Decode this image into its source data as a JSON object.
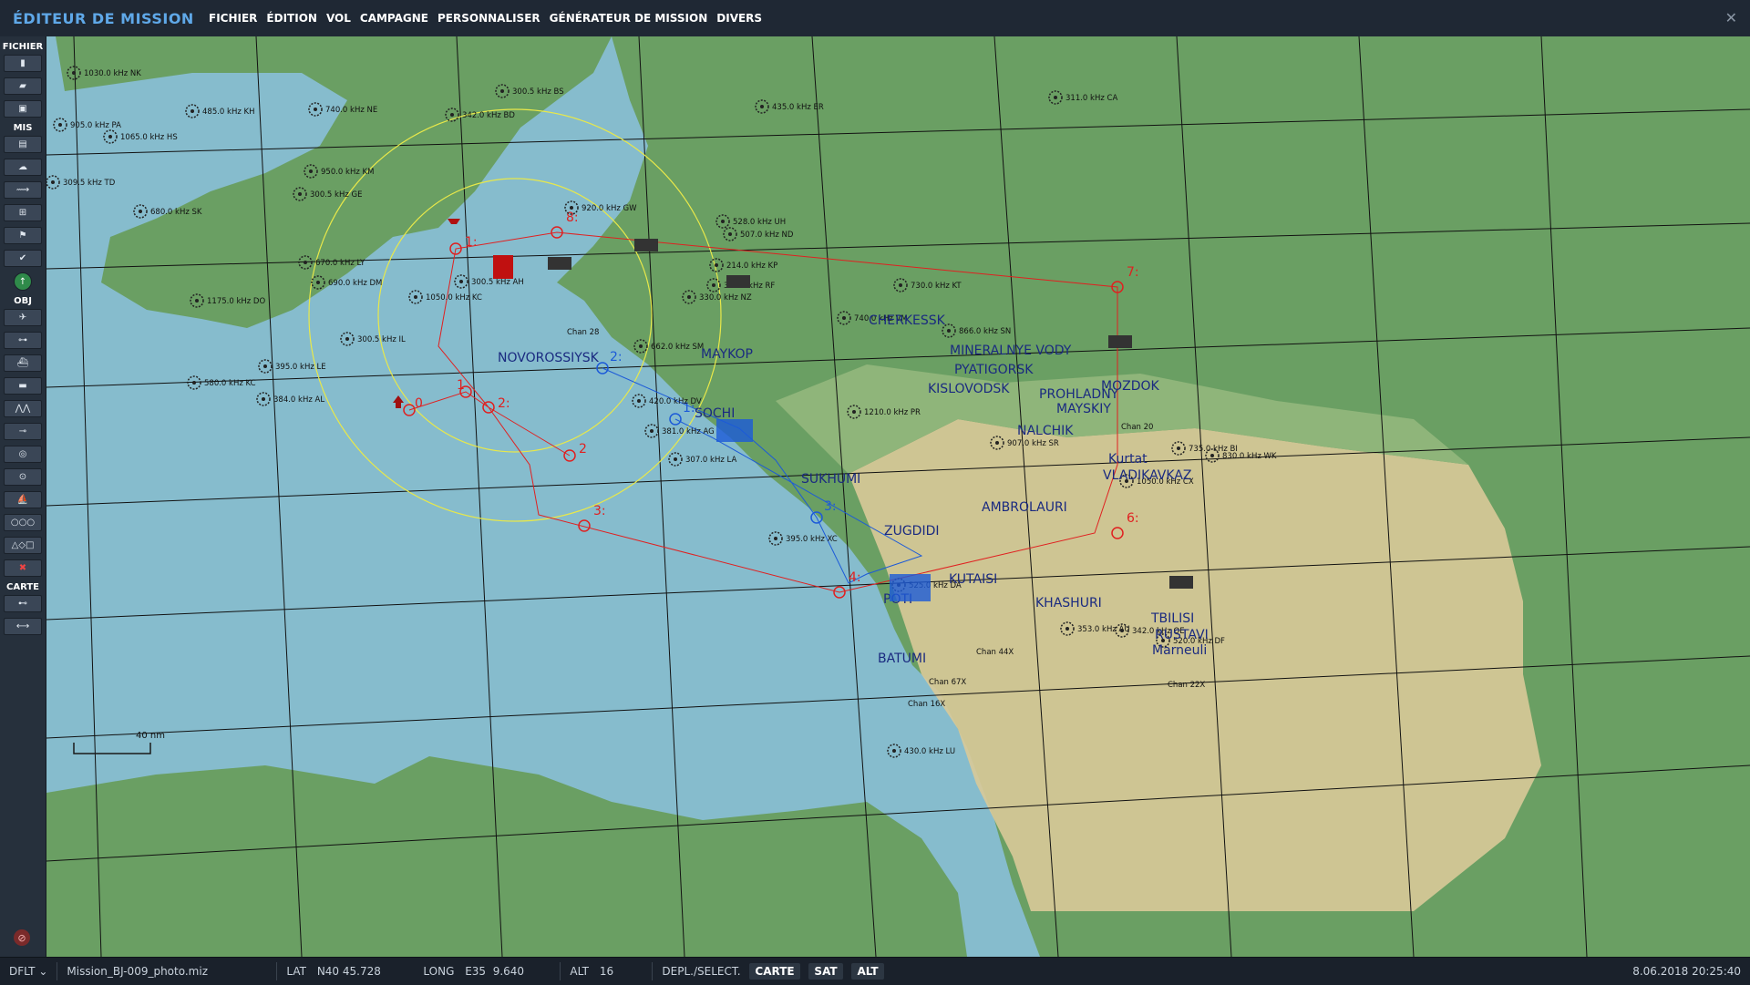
{
  "app": {
    "title": "ÉDITEUR DE MISSION",
    "close_icon": "close-icon"
  },
  "menu": [
    "FICHIER",
    "ÉDITION",
    "VOL",
    "CAMPAGNE",
    "PERSONNALISER",
    "GÉNÉRATEUR DE MISSION",
    "DIVERS"
  ],
  "sidebar": {
    "fichier_label": "FICHIER",
    "fichier_tools": [
      "new-file-icon",
      "open-folder-icon",
      "save-icon"
    ],
    "mis_label": "MIS",
    "mis_tools": [
      "briefing-icon",
      "weather-icon",
      "aircraft-route-icon",
      "triggers-icon",
      "flag-icon",
      "check-icon",
      "green-arrow-icon"
    ],
    "obj_label": "OBJ",
    "obj_tools": [
      "plane-icon",
      "helicopter-icon",
      "ship-icon",
      "vehicle-icon",
      "formation-icon",
      "static-object-icon",
      "trigger-zone-icon",
      "target-icon",
      "ship-group-icon",
      "template-icon",
      "shapes-icon",
      "delete-icon"
    ],
    "carte_label": "CARTE",
    "carte_tools": [
      "ruler-icon",
      "distance-icon"
    ]
  },
  "map": {
    "scale_label": "40 nm",
    "colors": {
      "sea": "#86bccd",
      "land_low": "#6a9f63",
      "land_mid": "#8fb57a",
      "mountains": "#d9c998",
      "red": "#e02020",
      "blue": "#1c5ad8",
      "yellow": "#e8e84a",
      "grid": "#111111"
    },
    "cities": [
      {
        "name": "NOVOROSSIYSK"
      },
      {
        "name": "SOCHI"
      },
      {
        "name": "SUKHUMI"
      },
      {
        "name": "MAYKOP"
      },
      {
        "name": "CHERKESSK"
      },
      {
        "name": "MINERALNYE VODY"
      },
      {
        "name": "PYATIGORSK"
      },
      {
        "name": "KISLOVODSK"
      },
      {
        "name": "PROHLADNY"
      },
      {
        "name": "MAYSKIY"
      },
      {
        "name": "NALCHIK"
      },
      {
        "name": "MOZDOK"
      },
      {
        "name": "Kurtat"
      },
      {
        "name": "VLADIKAVKAZ"
      },
      {
        "name": "AMBROLAURI"
      },
      {
        "name": "ZUGDIDI"
      },
      {
        "name": "KUTAISI"
      },
      {
        "name": "POTI"
      },
      {
        "name": "KHASHURI"
      },
      {
        "name": "BATUMI"
      },
      {
        "name": "TBILISI"
      },
      {
        "name": "RUSTAVI"
      },
      {
        "name": "Marneuli"
      }
    ],
    "beacons": [
      "1030.0 kHz NK",
      "905.0 kHz PA",
      "1065.0 kHz HS",
      "485.0 kHz KH",
      "740.0 kHz NE",
      "342.0 kHz BD",
      "300.5 kHz BS",
      "435.0 kHz ER",
      "311.0 kHz CA",
      "309.5 kHz TD",
      "950.0 kHz KM",
      "300.5 kHz GE",
      "680.0 kHz SK",
      "920.0 kHz GW",
      "528.0 kHz UH",
      "507.0 kHz ND",
      "214.0 kHz KP",
      "670.0 kHz LY",
      "690.0 kHz DM",
      "300.5 kHz AH",
      "1050.0 kHz KC",
      "324.0 kHz RF",
      "330.0 kHz NZ",
      "730.0 kHz KT",
      "1175.0 kHz DO",
      "740.0 kHz VM",
      "300.5 kHz IL",
      "395.0 kHz LE",
      "580.0 kHz KC",
      "384.0 kHz AL",
      "866.0 kHz SN",
      "662.0 kHz SM",
      "420.0 kHz DV",
      "381.0 kHz AG",
      "307.0 kHz LA",
      "1210.0 kHz PR",
      "907.0 kHz SR",
      "735.0 kHz BI",
      "830.0 kHz WK",
      "1050.0 kHz CX",
      "395.0 kHz XC",
      "525.0 kHz DA",
      "353.0 kHz AU",
      "342.0 kHz OE",
      "520.0 kHz DF",
      "430.0 kHz LU"
    ],
    "tacan": [
      "Chan 28",
      "Chan 67X",
      "Chan 16X",
      "Chan 44X",
      "Chan 22X",
      "Chan 20"
    ],
    "waypoints_red": [
      "0",
      "1",
      "2",
      "1:",
      "2:",
      "3:",
      "4:",
      "6:",
      "7:",
      "8:"
    ],
    "waypoints_blue": [
      "1:",
      "2:",
      "3:"
    ]
  },
  "status": {
    "profile": "DFLT",
    "file": "Mission_BJ-009_photo.miz",
    "lat_label": "LAT",
    "lat_value": "N40 45.728",
    "long_label": "LONG",
    "long_value": "E35  9.640",
    "alt_label": "ALT",
    "alt_value": "16",
    "mode_label": "DEPL./SELECT.",
    "mode_buttons": [
      "CARTE",
      "SAT",
      "ALT"
    ],
    "datetime": "8.06.2018 20:25:40"
  }
}
